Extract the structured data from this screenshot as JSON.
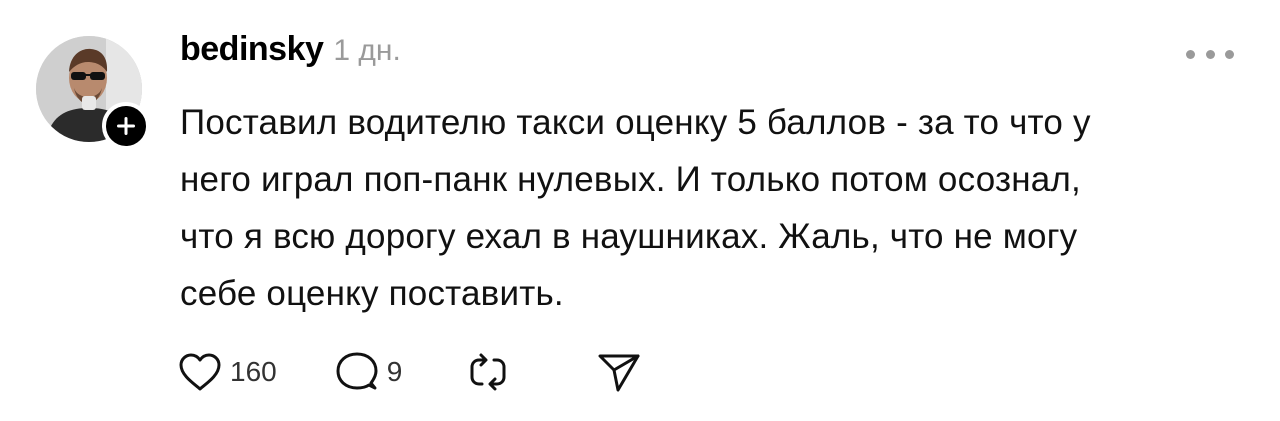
{
  "post": {
    "author": {
      "username": "bedinsky",
      "avatar": "avatar-photo",
      "follow_icon": "plus-icon"
    },
    "timestamp": "1 дн.",
    "more_icon": "ellipsis-icon",
    "text_lines": [
      "Поставил водителю такси оценку 5 баллов - за то что у",
      "него играл поп-панк нулевых. И только потом осознал,",
      "что я всю дорогу ехал в наушниках. Жаль, что не могу",
      "себе оценку поставить."
    ],
    "actions": {
      "like": {
        "icon": "heart-icon",
        "count": "160"
      },
      "reply": {
        "icon": "comment-icon",
        "count": "9"
      },
      "repost": {
        "icon": "repost-icon"
      },
      "share": {
        "icon": "send-icon"
      }
    }
  }
}
